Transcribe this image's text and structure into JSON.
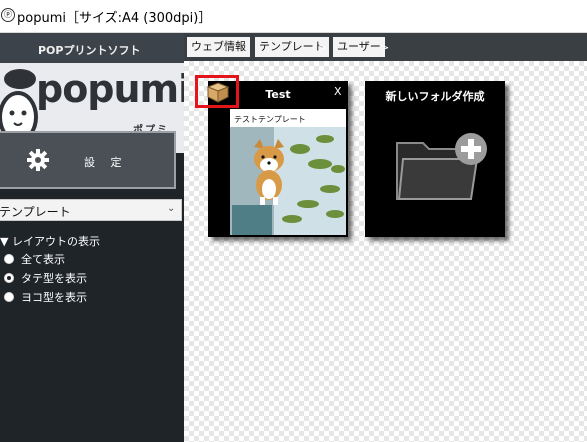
{
  "window": {
    "title": "popumi［サイズ:A4 (300dpi)］",
    "app_icon": "app-icon"
  },
  "sidebar": {
    "brand_header": "POPプリントソフト",
    "logo_word": "popumi",
    "logo_sub": "ポプミ",
    "settings_label": "設 定",
    "template_select": {
      "value": "テンプレート"
    },
    "layout_heading": "▼ レイアウトの表示",
    "layout_options": [
      {
        "label": "全て表示",
        "selected": false
      },
      {
        "label": "タテ型を表示",
        "selected": true
      },
      {
        "label": "ヨコ型を表示",
        "selected": false
      }
    ]
  },
  "breadcrumb": {
    "items": [
      {
        "label": "ウェブ情報"
      },
      {
        "label": "テンプレート"
      },
      {
        "label": "ユーザー"
      }
    ],
    "separator": ">"
  },
  "cards": [
    {
      "title": "Test",
      "close": "X",
      "thumb_label": "テストテンプレート",
      "icon": "box-icon"
    },
    {
      "title": "新しいフォルダ作成",
      "icon": "folder-plus-icon"
    }
  ],
  "colors": {
    "sidebar_bg": "#1f2429",
    "accent_red": "#e3141a",
    "card_bg": "#000000"
  }
}
